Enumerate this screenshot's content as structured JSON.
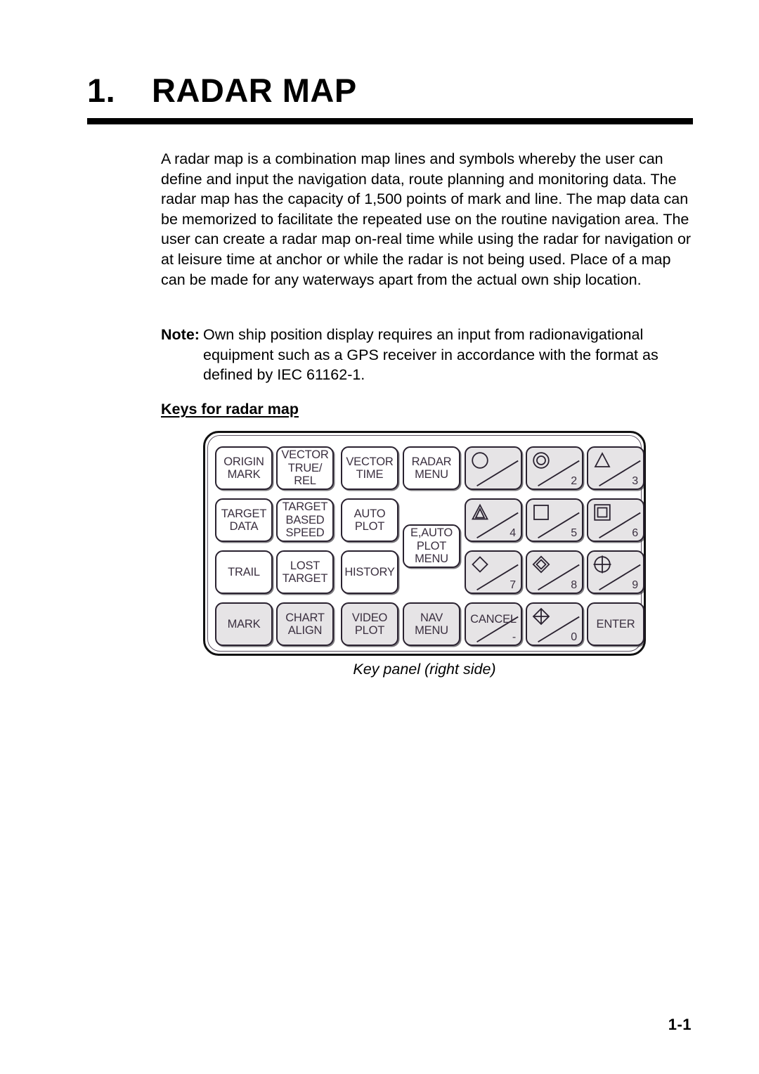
{
  "document": {
    "chapter_number": "1.",
    "chapter_title": "RADAR MAP",
    "page_number": "1-1"
  },
  "body": {
    "paragraph": "A radar map is a combination map lines and symbols whereby the user can define and input the navigation data, route planning and monitoring data. The radar map has the capacity of 1,500 points of mark and line. The map data can be memorized to facilitate the repeated use on the routine navigation area. The user can create a radar map on-real time while using the radar for navigation or at leisure time at anchor or while the radar is not being used. Place of a map can be made for any waterways apart from the actual own ship location."
  },
  "note": {
    "label": "Note:",
    "line1": "Own ship position display requires an input from radionavigational",
    "line2": "equipment such as a GPS receiver in accordance with the format as",
    "line3": "defined by IEC 61162-1."
  },
  "subheading": "Keys for radar map",
  "figure": {
    "caption": "Key panel (right side)",
    "keys": [
      {
        "name": "origin-mark",
        "label": "ORIGIN\nMARK",
        "style": "white"
      },
      {
        "name": "vector-true-rel",
        "label": "VECTOR\nTRUE/\nREL",
        "style": "white"
      },
      {
        "name": "vector-time",
        "label": "VECTOR\nTIME",
        "style": "white"
      },
      {
        "name": "radar-menu",
        "label": "RADAR\nMENU",
        "style": "white"
      },
      {
        "name": "target-data",
        "label": "TARGET\nDATA",
        "style": "white"
      },
      {
        "name": "target-based-speed",
        "label": "TARGET\nBASED\nSPEED",
        "style": "white"
      },
      {
        "name": "auto-plot",
        "label": "AUTO\nPLOT",
        "style": "white"
      },
      {
        "name": "e-auto-plot-menu",
        "label": "E,AUTO\nPLOT\nMENU",
        "style": "white"
      },
      {
        "name": "trail",
        "label": "TRAIL",
        "style": "white"
      },
      {
        "name": "lost-target",
        "label": "LOST\nTARGET",
        "style": "white"
      },
      {
        "name": "history",
        "label": "HISTORY",
        "style": "white"
      },
      {
        "name": "mark",
        "label": "MARK",
        "style": "gray"
      },
      {
        "name": "chart-align",
        "label": "CHART\nALIGN",
        "style": "gray"
      },
      {
        "name": "video-plot",
        "label": "VIDEO\nPLOT",
        "style": "gray"
      },
      {
        "name": "nav-menu",
        "label": "NAV\nMENU",
        "style": "gray"
      }
    ],
    "numeric_keys": [
      {
        "name": "key-1",
        "digit": "",
        "symbol": "circle",
        "style": "gray"
      },
      {
        "name": "key-2",
        "digit": "2",
        "symbol": "double-circle",
        "style": "gray"
      },
      {
        "name": "key-3",
        "digit": "3",
        "symbol": "triangle",
        "style": "gray"
      },
      {
        "name": "key-4",
        "digit": "4",
        "symbol": "double-triangle",
        "style": "gray"
      },
      {
        "name": "key-5",
        "digit": "5",
        "symbol": "square",
        "style": "gray"
      },
      {
        "name": "key-6",
        "digit": "6",
        "symbol": "double-square",
        "style": "gray"
      },
      {
        "name": "key-7",
        "digit": "7",
        "symbol": "diamond",
        "style": "gray"
      },
      {
        "name": "key-8",
        "digit": "8",
        "symbol": "double-diamond",
        "style": "gray"
      },
      {
        "name": "key-9",
        "digit": "9",
        "symbol": "circle-cross",
        "style": "gray"
      },
      {
        "name": "key-cancel",
        "digit": "-",
        "symbol": "none",
        "label": "CANCEL",
        "style": "gray"
      },
      {
        "name": "key-0",
        "digit": "0",
        "symbol": "diamond-cross",
        "style": "gray"
      },
      {
        "name": "key-enter",
        "digit": "",
        "symbol": "none",
        "label": "ENTER",
        "style": "gray"
      }
    ]
  }
}
